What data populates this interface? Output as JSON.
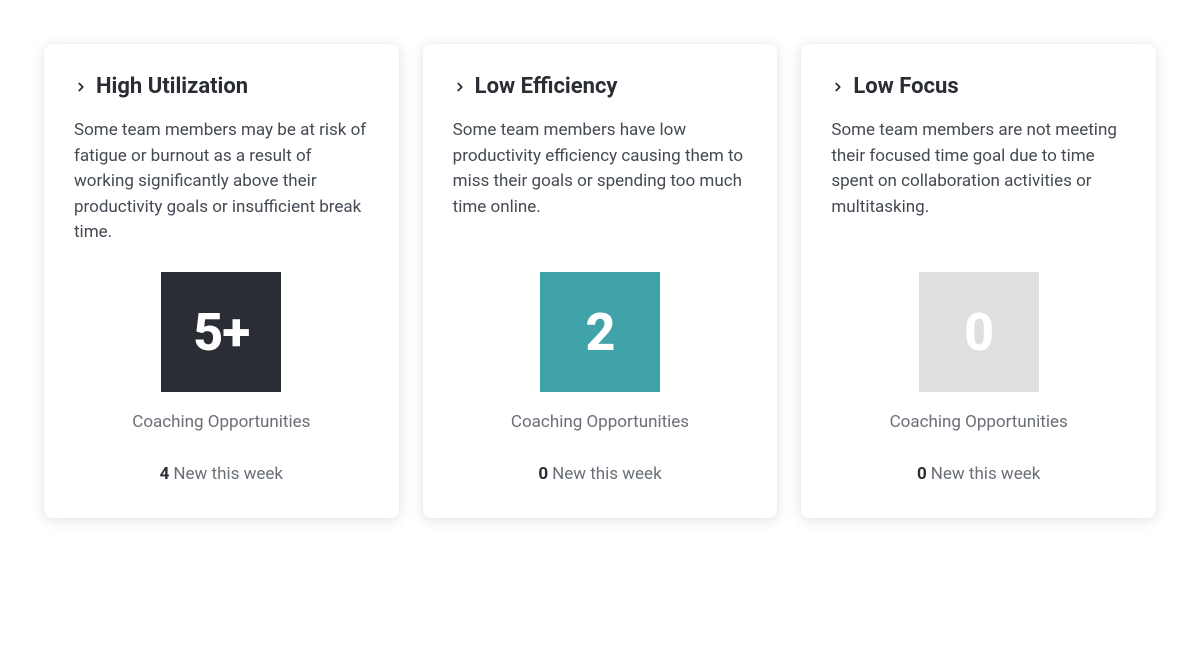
{
  "cards": [
    {
      "title": "High Utilization",
      "description": "Some team members may be at risk of fatigue or burnout as a result of working significantly above their productivity goals or insufficient break time.",
      "count_display": "5+",
      "tile_bg": "#2a2e34",
      "tile_fg": "#ffffff",
      "sub_label": "Coaching Opportunities",
      "new_count": "4",
      "new_label": "New this week"
    },
    {
      "title": "Low Efficiency",
      "description": "Some team members have low productivity efficiency causing them to miss their goals or spending too much time online.",
      "count_display": "2",
      "tile_bg": "#3fa3a9",
      "tile_fg": "#ffffff",
      "sub_label": "Coaching Opportunities",
      "new_count": "0",
      "new_label": "New this week"
    },
    {
      "title": "Low Focus",
      "description": "Some team members are not meeting their focused time goal due to time spent on collaboration activities or multitasking.",
      "count_display": "0",
      "tile_bg": "#dddfe1",
      "tile_fg": "#ffffff",
      "sub_label": "Coaching Opportunities",
      "new_count": "0",
      "new_label": "New this week"
    }
  ]
}
